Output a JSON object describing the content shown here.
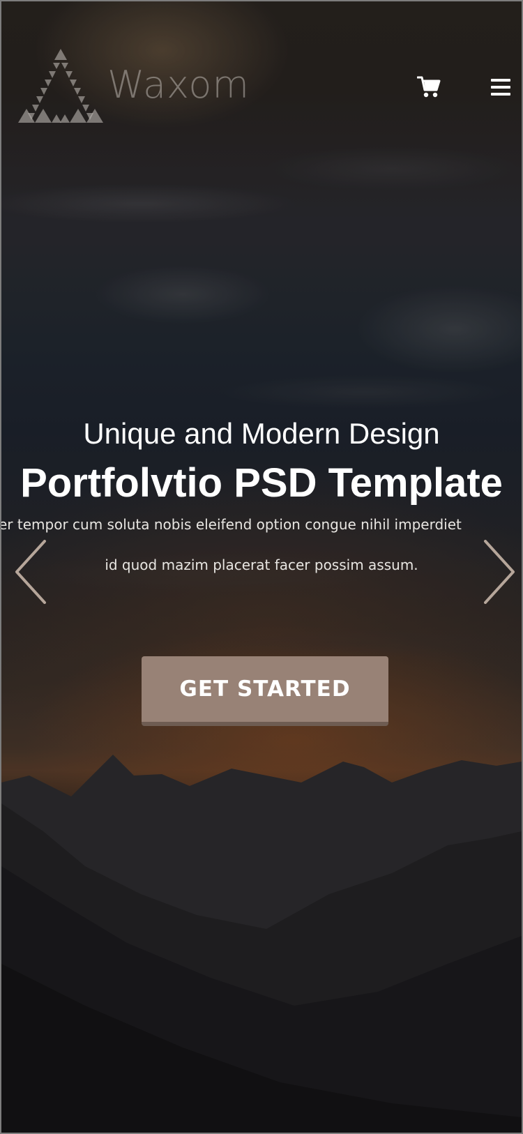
{
  "brand": {
    "name": "Waxom"
  },
  "header": {
    "icons": {
      "cart": "cart-icon",
      "menu": "hamburger-menu-icon"
    }
  },
  "hero": {
    "subtitle": "Unique and Modern Design",
    "title": "Portfolvtio PSD Template",
    "description_line_1": "er tempor cum soluta nobis eleifend option congue nihil imperdiet",
    "description_line_2": "id quod mazim placerat facer possim assum.",
    "cta_label": "GET STARTED",
    "prev_icon": "chevron-left-icon",
    "next_icon": "chevron-right-icon"
  },
  "colors": {
    "cta_background": "#988276",
    "cta_shadow": "#6e5c52",
    "text": "#ffffff",
    "logo": "#b9b4af"
  }
}
